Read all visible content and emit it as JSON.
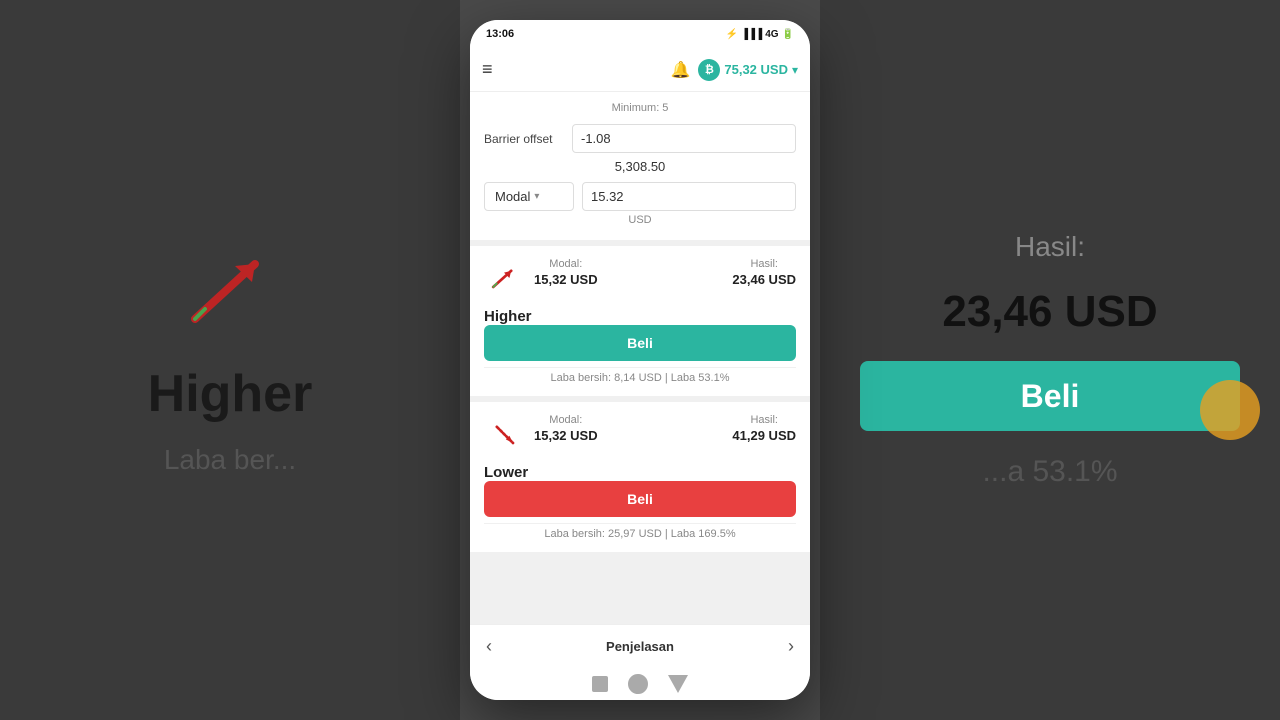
{
  "status_bar": {
    "time": "13:06",
    "icons": "🔋 📶 4G"
  },
  "header": {
    "menu_icon": "≡",
    "bell_icon": "🔔",
    "currency_symbol": "₿",
    "currency_label": "75,32 USD",
    "chevron": "▾"
  },
  "form": {
    "minimum_label": "Minimum: 5",
    "barrier_offset_label": "Barrier offset",
    "barrier_offset_value": "-1.08",
    "barrier_price": "5,308.50",
    "modal_label": "Modal",
    "modal_value": "15.32",
    "currency": "USD"
  },
  "higher_card": {
    "modal_label": "Modal:",
    "modal_value": "15,32 USD",
    "hasil_label": "Hasil:",
    "hasil_value": "23,46 USD",
    "trade_name": "Higher",
    "beli_label": "Beli",
    "laba_bersih": "Laba bersih: 8,14 USD | Laba 53.1%"
  },
  "lower_card": {
    "modal_label": "Modal:",
    "modal_value": "15,32 USD",
    "hasil_label": "Hasil:",
    "hasil_value": "41,29 USD",
    "trade_name": "Lower",
    "beli_label": "Beli",
    "laba_bersih": "Laba bersih: 25,97 USD | Laba 169.5%"
  },
  "bottom_nav": {
    "prev_icon": "‹",
    "label": "Penjelasan",
    "next_icon": "›"
  },
  "bg_left": {
    "higher_text": "Higher",
    "laba_text": "Laba ber..."
  },
  "bg_right": {
    "hasil_label": "Hasil:",
    "usd_value": "23,46 USD",
    "beli_label": "Beli",
    "laba_text": "...a 53.1%"
  }
}
